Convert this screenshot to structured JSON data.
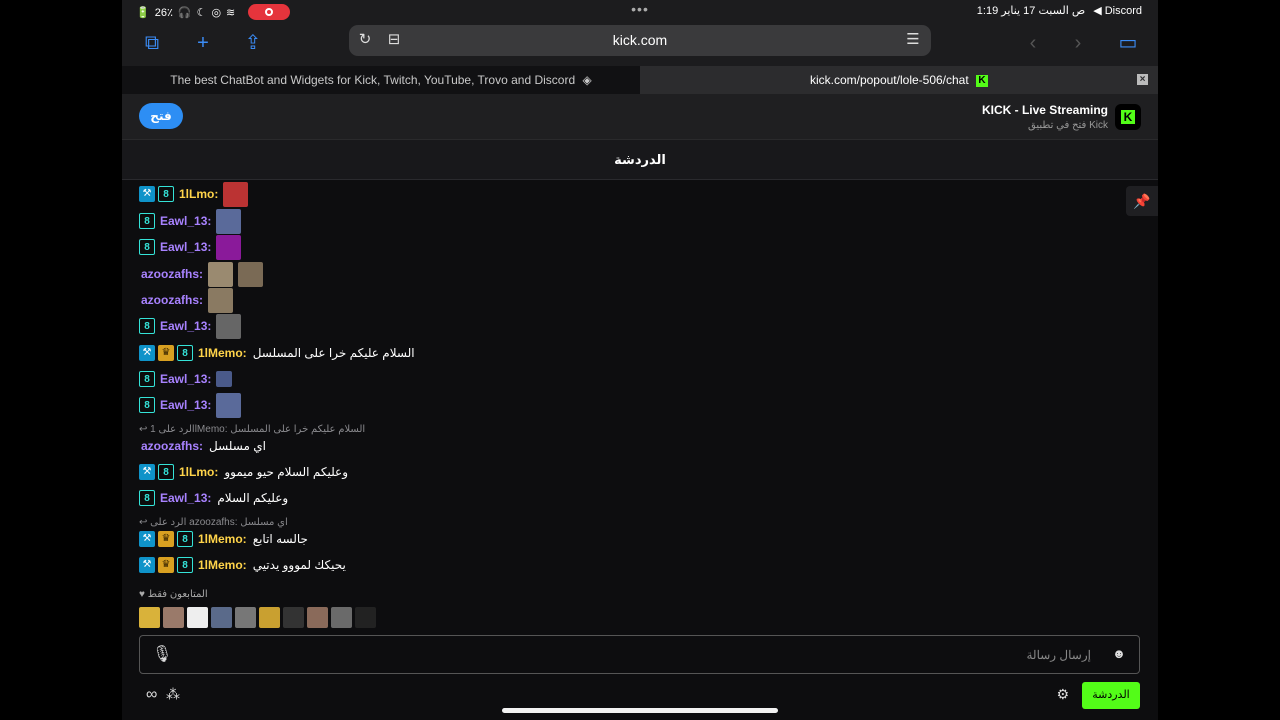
{
  "status": {
    "battery": "26٪",
    "time_date": "1:19 ص  السبت 17 يناير",
    "back_app": "◀ Discord",
    "more_dots": "•••"
  },
  "browser": {
    "url": "kick.com"
  },
  "tabs": [
    {
      "label": "The best ChatBot and Widgets for Kick, Twitch, YouTube, Trovo and Discord"
    },
    {
      "label": "kick.com/popout/lole-506/chat"
    }
  ],
  "banner": {
    "open_label": "فتح",
    "title": "KICK - Live Streaming",
    "subtitle": "فتح في تطبيق Kick"
  },
  "chat": {
    "title": "الدردشة",
    "messages": [
      {
        "user": "1lLmo:",
        "text": ""
      },
      {
        "user": "Eawl_13:",
        "text": ""
      },
      {
        "user": "Eawl_13:",
        "text": ""
      },
      {
        "user": "azoozafhs:",
        "text": ""
      },
      {
        "user": "azoozafhs:",
        "text": ""
      },
      {
        "user": "Eawl_13:",
        "text": ""
      },
      {
        "user": "1lMemo:",
        "text": "السلام عليكم خرا على المسلسل"
      },
      {
        "user": "Eawl_13:",
        "text": ""
      },
      {
        "user": "Eawl_13:",
        "text": ""
      },
      {
        "user": "azoozafhs:",
        "text": "اي مسلسل"
      },
      {
        "user": "1lLmo:",
        "text": "وعليكم السلام حيو ميموو"
      },
      {
        "user": "Eawl_13:",
        "text": "وعليكم السلام"
      },
      {
        "user": "1lMemo:",
        "text": "جالسه اتابع"
      },
      {
        "user": "1lMemo:",
        "text": "يحيكك لمووو يدتيي"
      }
    ],
    "replies": [
      {
        "text": "الرد على 1lMemo: السلام عليكم خرا على المسلسل"
      },
      {
        "text": "الرد على azoozafhs: اي مسلسل"
      }
    ],
    "followers_only": "المتابعون فقط",
    "input_placeholder": "إرسال رسالة",
    "chat_button": "الدردشة"
  },
  "colors": {
    "kick_green": "#53fc18",
    "ios_blue": "#3b8cf6"
  }
}
